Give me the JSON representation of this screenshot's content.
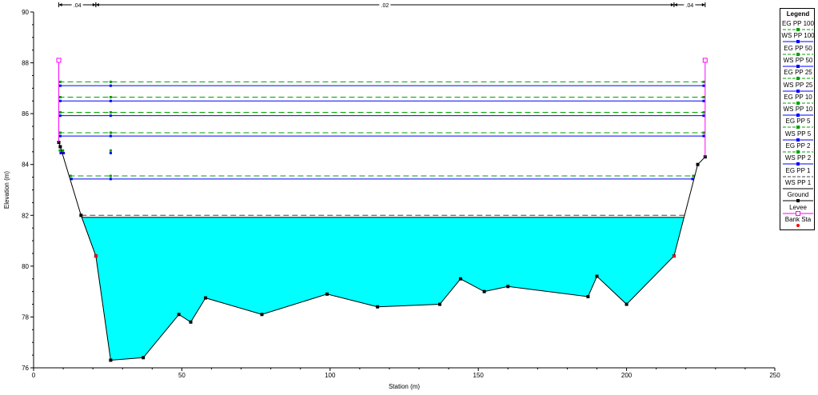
{
  "chart_data": {
    "type": "line",
    "title": "",
    "xlabel": "Station (m)",
    "ylabel": "Elevation (m)",
    "xlim": [
      0,
      250
    ],
    "ylim": [
      76,
      90
    ],
    "xticks": [
      0,
      50,
      100,
      150,
      200,
      250
    ],
    "yticks": [
      76,
      78,
      80,
      82,
      84,
      86,
      88,
      90
    ],
    "grid": false,
    "legend_position": "right",
    "legend_title": "Legend",
    "manning_n": [
      {
        "label": ".04",
        "from": 8.5,
        "to": 21
      },
      {
        "label": ".02",
        "from": 21,
        "to": 216
      },
      {
        "label": ".04",
        "from": 216,
        "to": 226.5
      }
    ],
    "ground": {
      "x": [
        8.5,
        9,
        16,
        21,
        26,
        37,
        49,
        53,
        58,
        77,
        99,
        116,
        137,
        144,
        152,
        160,
        187,
        190,
        200,
        216,
        224,
        226.5
      ],
      "y": [
        84.87,
        84.7,
        82.0,
        80.4,
        76.3,
        76.4,
        78.1,
        77.8,
        78.75,
        78.1,
        78.9,
        78.4,
        78.5,
        79.5,
        79.0,
        79.2,
        78.8,
        79.6,
        78.5,
        80.4,
        84.0,
        84.3
      ]
    },
    "levee": [
      {
        "x": 8.5,
        "y": 88.1
      },
      {
        "x": 226.5,
        "y": 88.1
      }
    ],
    "bank_stations": [
      {
        "x": 21,
        "y": 80.4
      },
      {
        "x": 216,
        "y": 80.4
      }
    ],
    "series": [
      {
        "name": "EG PP 100",
        "y": 87.25,
        "color": "#00a000",
        "style": "dashed"
      },
      {
        "name": "WS PP 100",
        "y": 87.1,
        "color": "#0000ff",
        "style": "solid"
      },
      {
        "name": "EG PP 50",
        "y": 86.65,
        "color": "#00a000",
        "style": "dashed"
      },
      {
        "name": "WS PP 50",
        "y": 86.5,
        "color": "#0000ff",
        "style": "solid"
      },
      {
        "name": "EG PP 25",
        "y": 86.05,
        "color": "#00a000",
        "style": "dashed"
      },
      {
        "name": "WS PP 25",
        "y": 85.92,
        "color": "#0000ff",
        "style": "solid"
      },
      {
        "name": "EG PP 10",
        "y": 85.25,
        "color": "#00a000",
        "style": "dashed"
      },
      {
        "name": "WS PP 10",
        "y": 85.12,
        "color": "#0000ff",
        "style": "solid"
      },
      {
        "name": "EG PP 5",
        "y": 84.55,
        "color": "#00a000",
        "style": "dashed"
      },
      {
        "name": "WS PP 5",
        "y": 84.45,
        "color": "#0000ff",
        "style": "solid"
      },
      {
        "name": "EG PP 2",
        "y": 83.55,
        "color": "#00a000",
        "style": "dashed"
      },
      {
        "name": "WS PP 2",
        "y": 83.43,
        "color": "#0000ff",
        "style": "solid"
      },
      {
        "name": "EG PP 1",
        "y": 82.0,
        "color": "#404040",
        "style": "dashed"
      },
      {
        "name": "WS PP 1",
        "y": 81.92,
        "color": "#000000",
        "style": "solid"
      }
    ],
    "water_fill_color": "#00ffff",
    "legend_entries": [
      {
        "label": "EG PP 100",
        "color": "#00a000",
        "marker": "square",
        "style": "dashed"
      },
      {
        "label": "WS PP 100",
        "color": "#0000ff",
        "marker": "square",
        "style": "solid"
      },
      {
        "label": "EG PP 50",
        "color": "#00a000",
        "marker": "triangle",
        "style": "dashed"
      },
      {
        "label": "WS PP 50",
        "color": "#0000ff",
        "marker": "triangle",
        "style": "solid"
      },
      {
        "label": "EG PP 25",
        "color": "#00a000",
        "marker": "square",
        "style": "dashed"
      },
      {
        "label": "WS PP 25",
        "color": "#0000ff",
        "marker": "square",
        "style": "solid"
      },
      {
        "label": "EG PP 10",
        "color": "#00a000",
        "marker": "tri-open",
        "style": "dashed"
      },
      {
        "label": "WS PP 10",
        "color": "#0000ff",
        "marker": "tri-open",
        "style": "solid"
      },
      {
        "label": "EG PP 5",
        "color": "#00a000",
        "marker": "triangle-down",
        "style": "dashed"
      },
      {
        "label": "WS PP 5",
        "color": "#0000ff",
        "marker": "triangle-down",
        "style": "solid"
      },
      {
        "label": "EG PP 2",
        "color": "#00a000",
        "marker": "triangle",
        "style": "dashed"
      },
      {
        "label": "WS PP 2",
        "color": "#0000ff",
        "marker": "triangle",
        "style": "solid"
      },
      {
        "label": "EG PP 1",
        "color": "#404040",
        "marker": "none",
        "style": "dashed"
      },
      {
        "label": "WS PP 1",
        "color": "#000000",
        "marker": "none",
        "style": "solid"
      },
      {
        "label": "Ground",
        "color": "#000000",
        "marker": "square",
        "style": "solid"
      },
      {
        "label": "Levee",
        "color": "#ff00ff",
        "marker": "square-open",
        "style": "solid"
      },
      {
        "label": "Bank Sta",
        "color": "#ff0000",
        "marker": "dot",
        "style": "none"
      }
    ]
  }
}
